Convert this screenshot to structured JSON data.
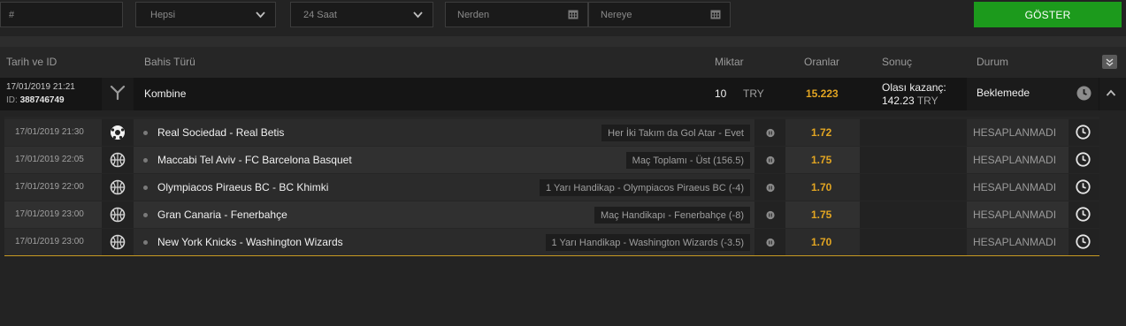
{
  "filters": {
    "hash_placeholder": "#",
    "type_select": "Hepsi",
    "time_select": "24 Saat",
    "from_placeholder": "Nerden",
    "to_placeholder": "Nereye",
    "show_button": "GÖSTER"
  },
  "table": {
    "headers": {
      "date_id": "Tarih ve ID",
      "bet_type": "Bahis Türü",
      "amount": "Miktar",
      "odds": "Oranlar",
      "result": "Sonuç",
      "status": "Durum"
    },
    "summary": {
      "date": "17/01/2019 21:21",
      "id_label": "ID:",
      "id_value": "388746749",
      "bet_type": "Kombine",
      "amount": "10",
      "currency": "TRY",
      "odds": "15.223",
      "potential_label": "Olası kazanç:",
      "potential_value": "142.23",
      "potential_currency": "TRY",
      "status": "Beklemede"
    },
    "selections": [
      {
        "date": "17/01/2019 21:30",
        "sport_icon": "soccer-ball-icon",
        "match": "Real Sociedad - Real Betis",
        "market": "Her İki Takım da Gol Atar - Evet",
        "odds": "1.72",
        "status": "HESAPLANMADI"
      },
      {
        "date": "17/01/2019 22:05",
        "sport_icon": "basketball-icon",
        "match": "Maccabi Tel Aviv - FC Barcelona Basquet",
        "market": "Maç Toplamı - Üst (156.5)",
        "odds": "1.75",
        "status": "HESAPLANMADI"
      },
      {
        "date": "17/01/2019 22:00",
        "sport_icon": "basketball-icon",
        "match": "Olympiacos Piraeus BC - BC Khimki",
        "market": "1 Yarı Handikap - Olympiacos Piraeus BC (-4)",
        "odds": "1.70",
        "status": "HESAPLANMADI"
      },
      {
        "date": "17/01/2019 23:00",
        "sport_icon": "basketball-icon",
        "match": "Gran Canaria - Fenerbahçe",
        "market": "Maç Handikapı - Fenerbahçe (-8)",
        "odds": "1.75",
        "status": "HESAPLANMADI"
      },
      {
        "date": "17/01/2019 23:00",
        "sport_icon": "basketball-icon",
        "match": "New York Knicks - Washington Wizards",
        "market": "1 Yarı Handikap - Washington Wizards (-3.5)",
        "odds": "1.70",
        "status": "HESAPLANMADI"
      }
    ]
  },
  "colors": {
    "accent_green": "#1c9a1c",
    "odds_gold": "#e2a522",
    "background": "#232323"
  }
}
